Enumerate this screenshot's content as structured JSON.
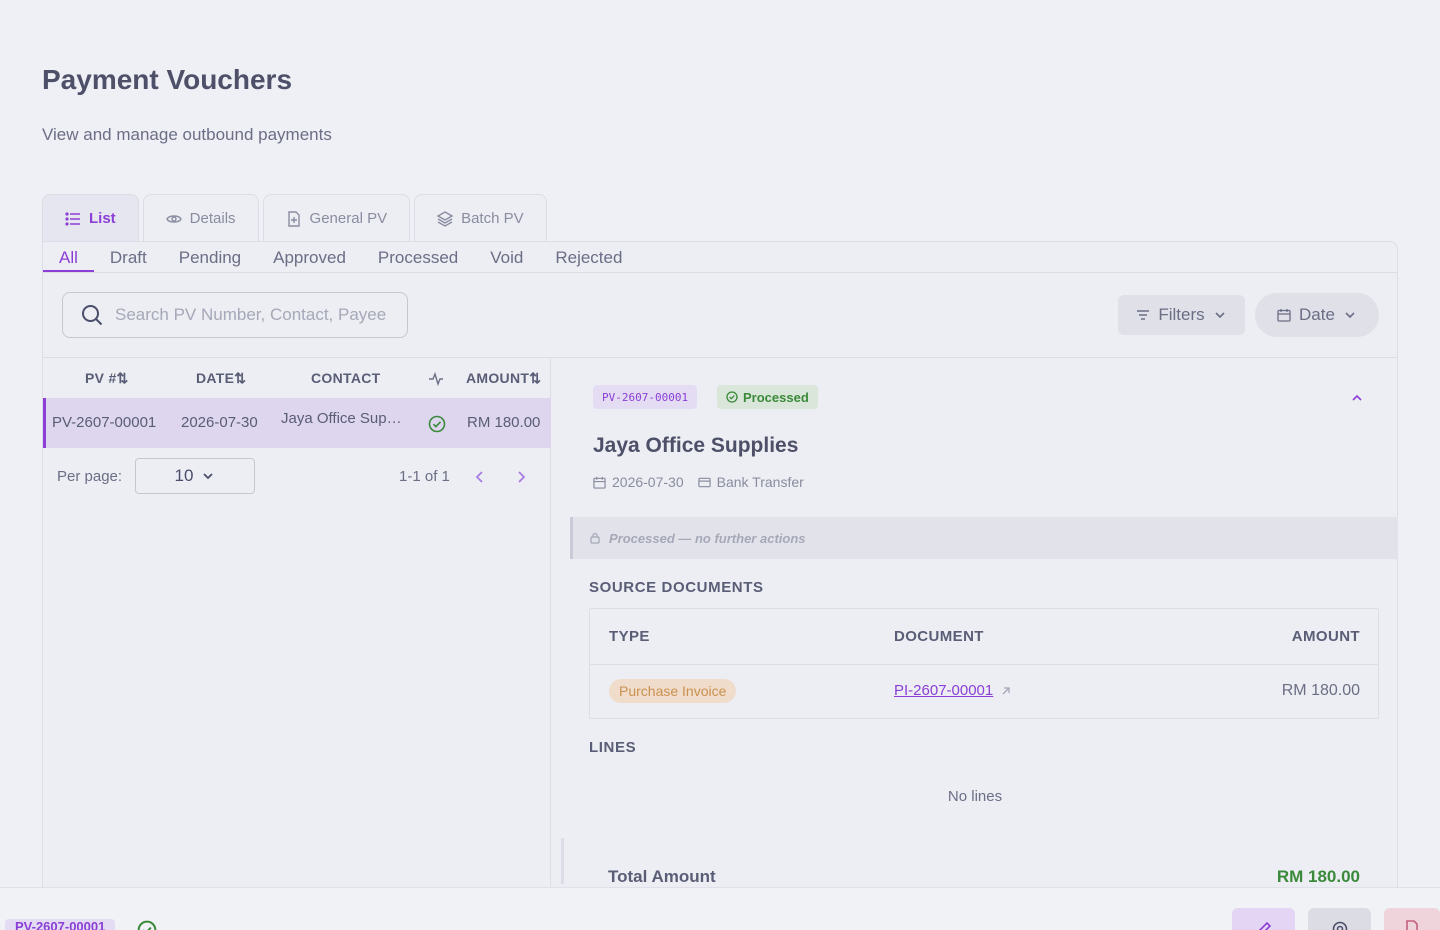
{
  "header": {
    "title": "Payment Vouchers",
    "subtitle": "View and manage outbound payments"
  },
  "view_tabs": [
    {
      "label": "List",
      "icon": "list-icon",
      "active": true
    },
    {
      "label": "Details",
      "icon": "eye-icon",
      "active": false
    },
    {
      "label": "General PV",
      "icon": "file-plus-icon",
      "active": false
    },
    {
      "label": "Batch PV",
      "icon": "layers-icon",
      "active": false
    }
  ],
  "status_tabs": [
    {
      "label": "All",
      "active": true
    },
    {
      "label": "Draft"
    },
    {
      "label": "Pending"
    },
    {
      "label": "Approved"
    },
    {
      "label": "Processed"
    },
    {
      "label": "Void"
    },
    {
      "label": "Rejected"
    }
  ],
  "toolbar": {
    "search_placeholder": "Search PV Number, Contact, Payee",
    "filters_label": "Filters",
    "date_label": "Date"
  },
  "list": {
    "columns": {
      "pv": "PV #⇅",
      "date": "DATE⇅",
      "contact": "CONTACT",
      "amount": "AMOUNT⇅"
    },
    "rows": [
      {
        "pv": "PV-2607-00001",
        "date": "2026-07-30",
        "contact": "Jaya Office Sup…",
        "status_icon": "check-circle-icon",
        "amount": "RM 180.00"
      }
    ],
    "pager": {
      "per_page_label": "Per page:",
      "per_page_value": "10",
      "range": "1-1 of 1"
    }
  },
  "detail": {
    "pv_number": "PV-2607-00001",
    "status": "Processed",
    "vendor": "Jaya Office Supplies",
    "date": "2026-07-30",
    "payment_method": "Bank Transfer",
    "locked_message": "Processed — no further actions",
    "source_documents": {
      "title": "SOURCE DOCUMENTS",
      "columns": {
        "type": "TYPE",
        "document": "DOCUMENT",
        "amount": "AMOUNT"
      },
      "rows": [
        {
          "type": "Purchase Invoice",
          "document": "PI-2607-00001",
          "amount": "RM 180.00"
        }
      ]
    },
    "lines": {
      "title": "LINES",
      "empty": "No lines"
    },
    "total": {
      "label": "Total Amount",
      "value": "RM 180.00"
    }
  },
  "bottom_bar": {
    "pv_number": "PV-2607-00001"
  },
  "colors": {
    "accent": "#8b3fd6",
    "success": "#3b8a3b",
    "badge_orange": "#c9914f"
  }
}
